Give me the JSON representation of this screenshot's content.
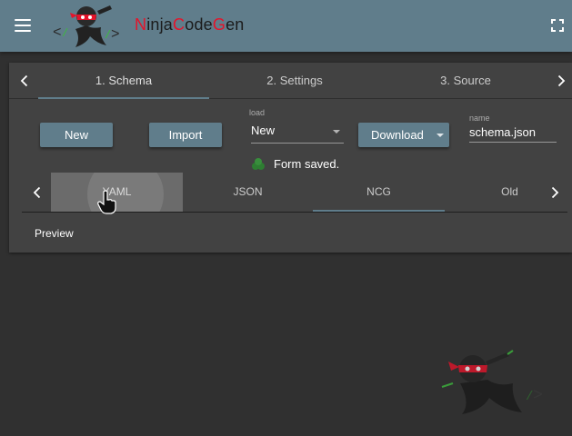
{
  "app": {
    "brand": {
      "N": "N",
      "inja": "inja",
      "C": "C",
      "ode": "ode",
      "G": "G",
      "en": "en"
    },
    "menu_icon": "hamburger-icon",
    "fullscreen_icon": "fullscreen-icon"
  },
  "tabs": [
    {
      "label": "1. Schema",
      "active": true
    },
    {
      "label": "2. Settings",
      "active": false
    },
    {
      "label": "3. Source",
      "active": false
    }
  ],
  "toolbar": {
    "new_label": "New",
    "import_label": "Import",
    "load_label": "load",
    "load_value": "New",
    "download_label": "Download",
    "name_label": "name",
    "name_value": "schema.json"
  },
  "status": {
    "text": "Form saved.",
    "icon": "saved-icon"
  },
  "subtabs": [
    {
      "label": "YAML",
      "hovered": true
    },
    {
      "label": "JSON",
      "active": false
    },
    {
      "label": "NCG",
      "active": true
    },
    {
      "label": "Old",
      "active": false
    }
  ],
  "preview_label": "Preview",
  "colors": {
    "accent": "#607d8b",
    "brand_red": "#e5132a",
    "background": "#303030",
    "card": "#424242",
    "status_green": "#2e7d32"
  }
}
